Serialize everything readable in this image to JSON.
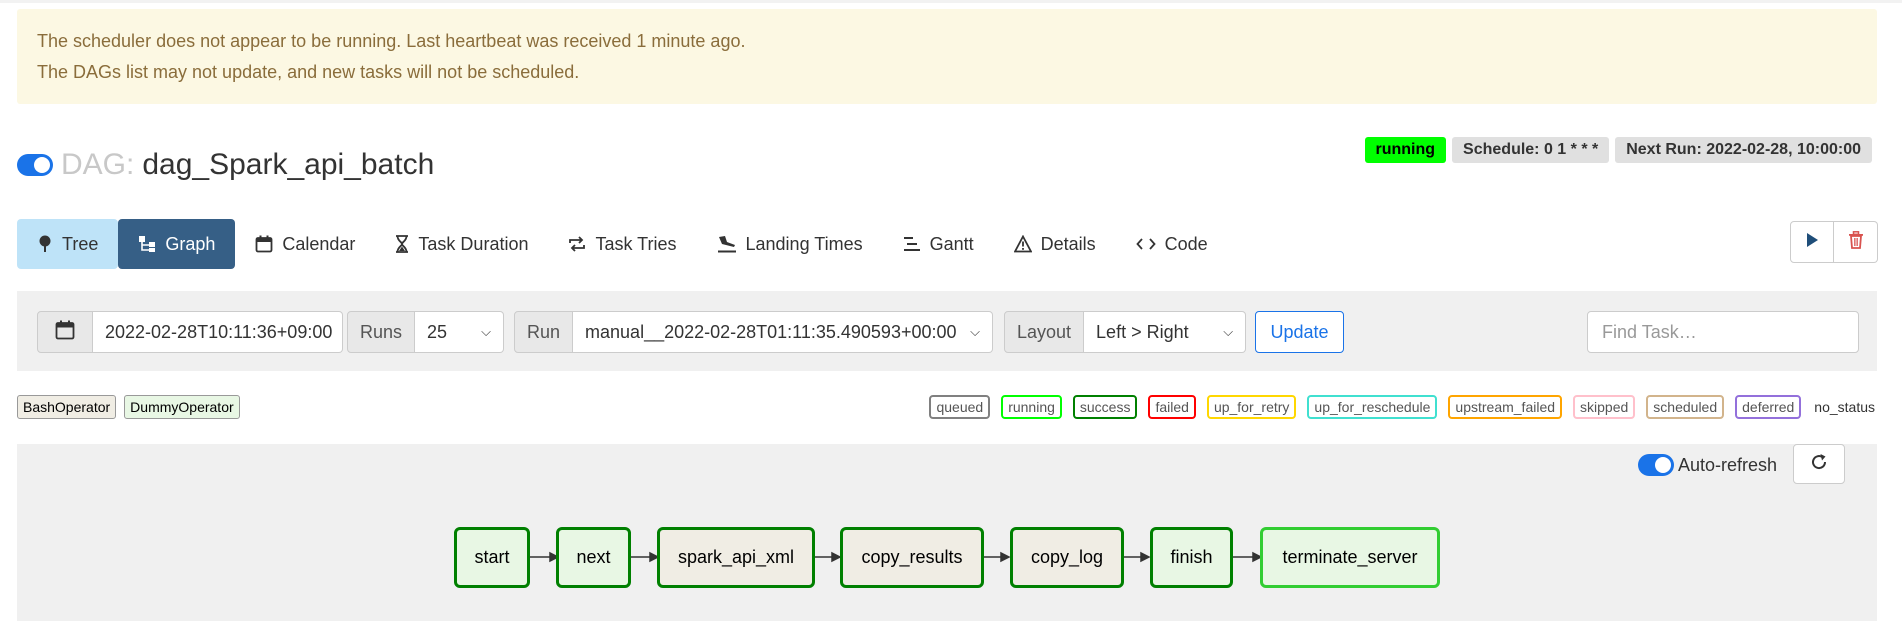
{
  "alert": {
    "line1": "The scheduler does not appear to be running. Last heartbeat was received 1 minute ago.",
    "line2": "The DAGs list may not update, and new tasks will not be scheduled."
  },
  "dag": {
    "prefix": "DAG:",
    "dag_id": "dag_Spark_api_batch",
    "state": "running",
    "schedule": "Schedule: 0 1 * * *",
    "next_run": "Next Run: 2022-02-28, 10:00:00"
  },
  "tabs": [
    {
      "label": "Tree",
      "icon": "tree-icon"
    },
    {
      "label": "Graph",
      "icon": "graph-icon"
    },
    {
      "label": "Calendar",
      "icon": "calendar-icon"
    },
    {
      "label": "Task Duration",
      "icon": "hourglass-icon"
    },
    {
      "label": "Task Tries",
      "icon": "repeat-icon"
    },
    {
      "label": "Landing Times",
      "icon": "plane-landing-icon"
    },
    {
      "label": "Gantt",
      "icon": "gantt-icon"
    },
    {
      "label": "Details",
      "icon": "warning-triangle-icon"
    },
    {
      "label": "Code",
      "icon": "code-icon"
    }
  ],
  "filters": {
    "base_date": "2022-02-28T10:11:36+09:00",
    "runs_label": "Runs",
    "runs_value": "25",
    "run_label": "Run",
    "run_value": "manual__2022-02-28T01:11:35.490593+00:00",
    "layout_label": "Layout",
    "layout_value": "Left > Right",
    "update_label": "Update",
    "find_placeholder": "Find Task…"
  },
  "operators": [
    {
      "label": "BashOperator",
      "color": "#f0ede4"
    },
    {
      "label": "DummyOperator",
      "color": "#e8f7e4"
    }
  ],
  "states": [
    {
      "label": "queued",
      "color": "#808080"
    },
    {
      "label": "running",
      "color": "#00ff00"
    },
    {
      "label": "success",
      "color": "#008000"
    },
    {
      "label": "failed",
      "color": "#ff0000"
    },
    {
      "label": "up_for_retry",
      "color": "#ffd700"
    },
    {
      "label": "up_for_reschedule",
      "color": "#40e0d0"
    },
    {
      "label": "upstream_failed",
      "color": "#ffa500"
    },
    {
      "label": "skipped",
      "color": "#ffc0cb"
    },
    {
      "label": "scheduled",
      "color": "#d2b48c"
    },
    {
      "label": "deferred",
      "color": "#9370db"
    },
    {
      "label": "no_status",
      "color": ""
    }
  ],
  "graph": {
    "autorefresh_label": "Auto-refresh",
    "nodes": [
      {
        "label": "start"
      },
      {
        "label": "next"
      },
      {
        "label": "spark_api_xml"
      },
      {
        "label": "copy_results"
      },
      {
        "label": "copy_log"
      },
      {
        "label": "finish"
      },
      {
        "label": "terminate_server"
      }
    ]
  }
}
